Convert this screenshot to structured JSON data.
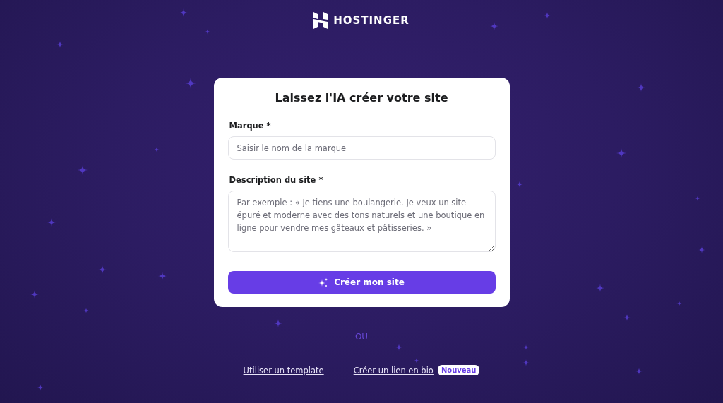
{
  "brand": {
    "name": "HOSTINGER"
  },
  "card": {
    "title": "Laissez l'IA créer votre site",
    "fields": [
      {
        "kind": "input",
        "label": "Marque *",
        "placeholder": "Saisir le nom de la marque"
      },
      {
        "kind": "textarea",
        "label": "Description du site *",
        "placeholder": "Par exemple : « Je tiens une boulangerie. Je veux un site épuré et moderne avec des tons naturels et une boutique en ligne pour vendre mes gâteaux et pâtisseries. »"
      }
    ],
    "submit": "Créer mon site"
  },
  "divider": "OU",
  "links": [
    {
      "label": "Utiliser un template"
    },
    {
      "label": "Créer un lien en bio",
      "badge": "Nouveau"
    }
  ]
}
